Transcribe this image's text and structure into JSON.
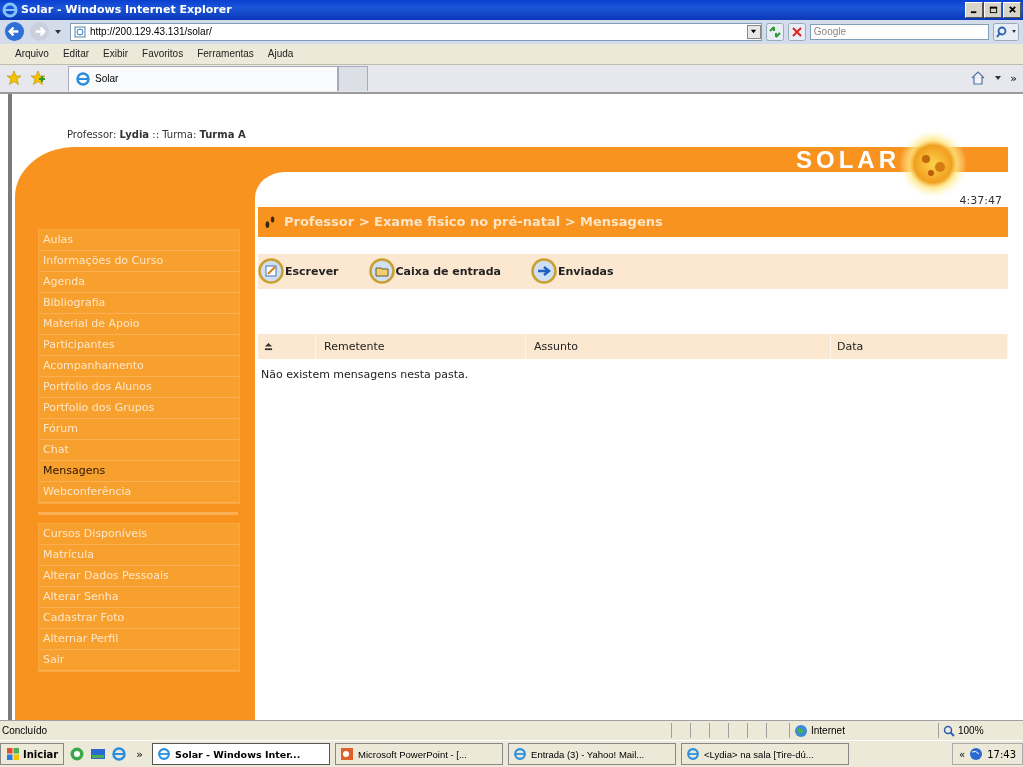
{
  "window": {
    "title": "Solar - Windows Internet Explorer"
  },
  "address_bar": {
    "url": "http://200.129.43.131/solar/",
    "search_placeholder": "Google"
  },
  "menu_bar": [
    "Arquivo",
    "Editar",
    "Exibir",
    "Favoritos",
    "Ferramentas",
    "Ajuda"
  ],
  "tabs": [
    {
      "label": "Solar",
      "selected": true
    }
  ],
  "more_tools": "»",
  "header": "Professor: **Lydia** :: Turma: **Turma A**",
  "logo": "SOLAR",
  "clock": "4:37:47",
  "breadcrumb": "Professor > Exame fisico no pré-natal > Mensagens",
  "sidebar": {
    "groups": [
      [
        {
          "label": "Aulas",
          "selected": false
        },
        {
          "label": "Informações do Curso",
          "selected": false
        },
        {
          "label": "Agenda",
          "selected": false
        },
        {
          "label": "Bibliografia",
          "selected": false
        },
        {
          "label": "Material de Apoio",
          "selected": false
        },
        {
          "label": "Participantes",
          "selected": false
        },
        {
          "label": "Acompanhamento",
          "selected": false
        },
        {
          "label": "Portfolio dos Alunos",
          "selected": false
        },
        {
          "label": "Portfolio dos Grupos",
          "selected": false
        },
        {
          "label": "Fórum",
          "selected": false
        },
        {
          "label": "Chat",
          "selected": false
        },
        {
          "label": "Mensagens",
          "selected": true
        },
        {
          "label": "Webconferência",
          "selected": false
        }
      ],
      [
        {
          "label": "Cursos Disponíveis",
          "selected": false
        },
        {
          "label": "Matrícula",
          "selected": false
        },
        {
          "label": "Alterar Dados Pessoais",
          "selected": false
        },
        {
          "label": "Alterar Senha",
          "selected": false
        },
        {
          "label": "Cadastrar Foto",
          "selected": false
        },
        {
          "label": "Alternar Perfil",
          "selected": false
        },
        {
          "label": "Sair",
          "selected": false
        }
      ]
    ]
  },
  "actions": [
    "Escrever",
    "Caixa de entrada",
    "Enviadas"
  ],
  "table": {
    "columns": [
      "Remetente",
      "Assunto",
      "Data"
    ],
    "empty_message": "Não existem mensagens nesta pasta."
  },
  "status_bar": {
    "text": "Concluído",
    "zone": "Internet",
    "zoom": "100%"
  },
  "taskbar": {
    "start": "Iniciar",
    "chevron": "»",
    "tasks": [
      {
        "label": "Solar - Windows Inter...",
        "selected": true
      },
      {
        "label": "Microsoft PowerPoint - [...",
        "selected": false
      },
      {
        "label": "Entrada (3) - Yahoo! Mail...",
        "selected": false
      },
      {
        "label": "<Lydia> na sala [Tire-dú...",
        "selected": false
      }
    ],
    "tray_toggle": "«",
    "time": "17:43"
  }
}
